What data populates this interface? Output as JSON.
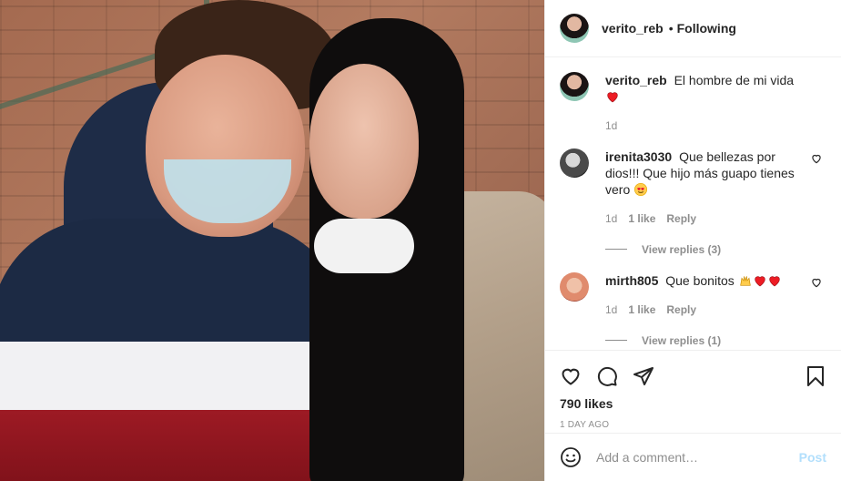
{
  "header": {
    "username": "verito_reb",
    "separator": "•",
    "follow_status": "Following"
  },
  "caption": {
    "username": "verito_reb",
    "text": "El hombre de mi vida",
    "time": "1d"
  },
  "comments": [
    {
      "username": "irenita3030",
      "text": "Que bellezas por dios!!! Que hijo más guapo tienes vero",
      "time": "1d",
      "likes": "1 like",
      "reply": "Reply",
      "view_replies": "View replies (3)"
    },
    {
      "username": "mirth805",
      "text": "Que bonitos",
      "time": "1d",
      "likes": "1 like",
      "reply": "Reply",
      "view_replies": "View replies (1)"
    }
  ],
  "actions": {
    "likes": "790 likes",
    "time_ago": "1 DAY AGO"
  },
  "add_comment": {
    "placeholder": "Add a comment…",
    "post_label": "Post"
  },
  "colors": {
    "heart_red": "#ed1c24",
    "post_button": "#b2dffc",
    "muted": "#8e8e8e"
  }
}
